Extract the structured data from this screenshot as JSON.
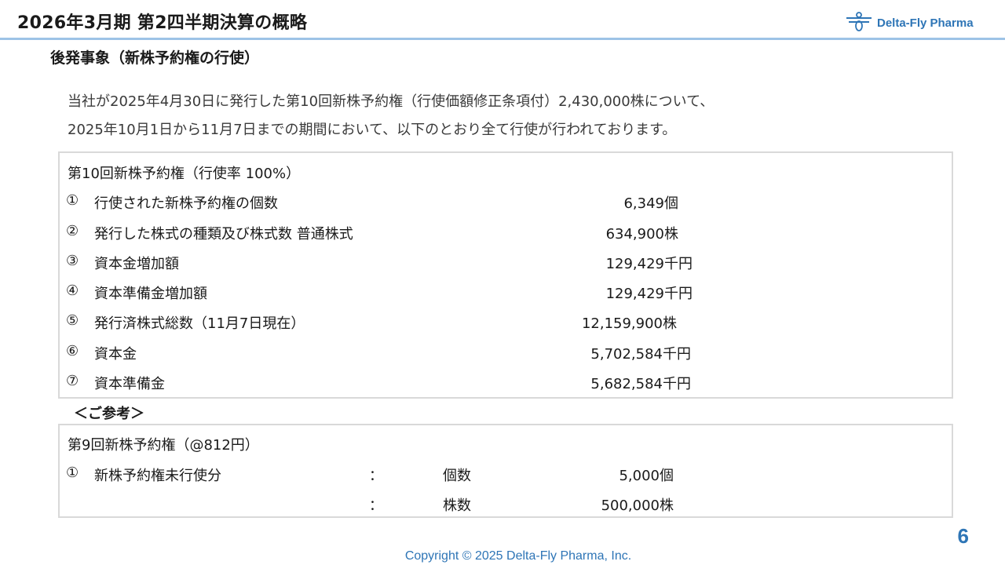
{
  "colors": {
    "accent": "#9dc3e6",
    "brand": "#2e75b6",
    "border": "#d9d9d9"
  },
  "header": {
    "title": "2026年3月期 第2四半期決算の概略",
    "logo_text": "Delta-Fly Pharma",
    "logo_icon": "dragonfly-icon"
  },
  "section_heading": "後発事象（新株予約権の行使）",
  "intro": [
    "当社が2025年4月30日に発行した第10回新株予約権（行使価額修正条項付）2,430,000株について、",
    "2025年10月1日から11月7日までの期間において、以下のとおり全て行使が行われております。"
  ],
  "box1": {
    "title": "第10回新株予約権（行使率 100%）",
    "rows": [
      {
        "marker": "①",
        "label": "行使された新株予約権の個数",
        "value": "6,349個"
      },
      {
        "marker": "②",
        "label": "発行した株式の種類及び株式数 普通株式",
        "value": "634,900株"
      },
      {
        "marker": "③",
        "label": "資本金増加額",
        "value": "129,429千円"
      },
      {
        "marker": "④",
        "label": "資本準備金増加額",
        "value": "129,429千円"
      },
      {
        "marker": "⑤",
        "label": "発行済株式総数（11月7日現在）",
        "value": "12,159,900株"
      },
      {
        "marker": "⑥",
        "label": "資本金",
        "value": "5,702,584千円"
      },
      {
        "marker": "⑦",
        "label": "資本準備金",
        "value": "5,682,584千円"
      }
    ]
  },
  "reference_label": "＜ご参考＞",
  "box2": {
    "title": "第9回新株予約権（@812円）",
    "rows": [
      {
        "marker": "①",
        "label": "新株予約権未行使分",
        "colon": "：",
        "unit_label": "個数",
        "value": "5,000個"
      },
      {
        "marker": "",
        "label": "",
        "colon": "：",
        "unit_label": "株数",
        "value": "500,000株"
      }
    ]
  },
  "footer": {
    "copyright": "Copyright © 2025  Delta-Fly Pharma, Inc.",
    "page_number": "6"
  }
}
